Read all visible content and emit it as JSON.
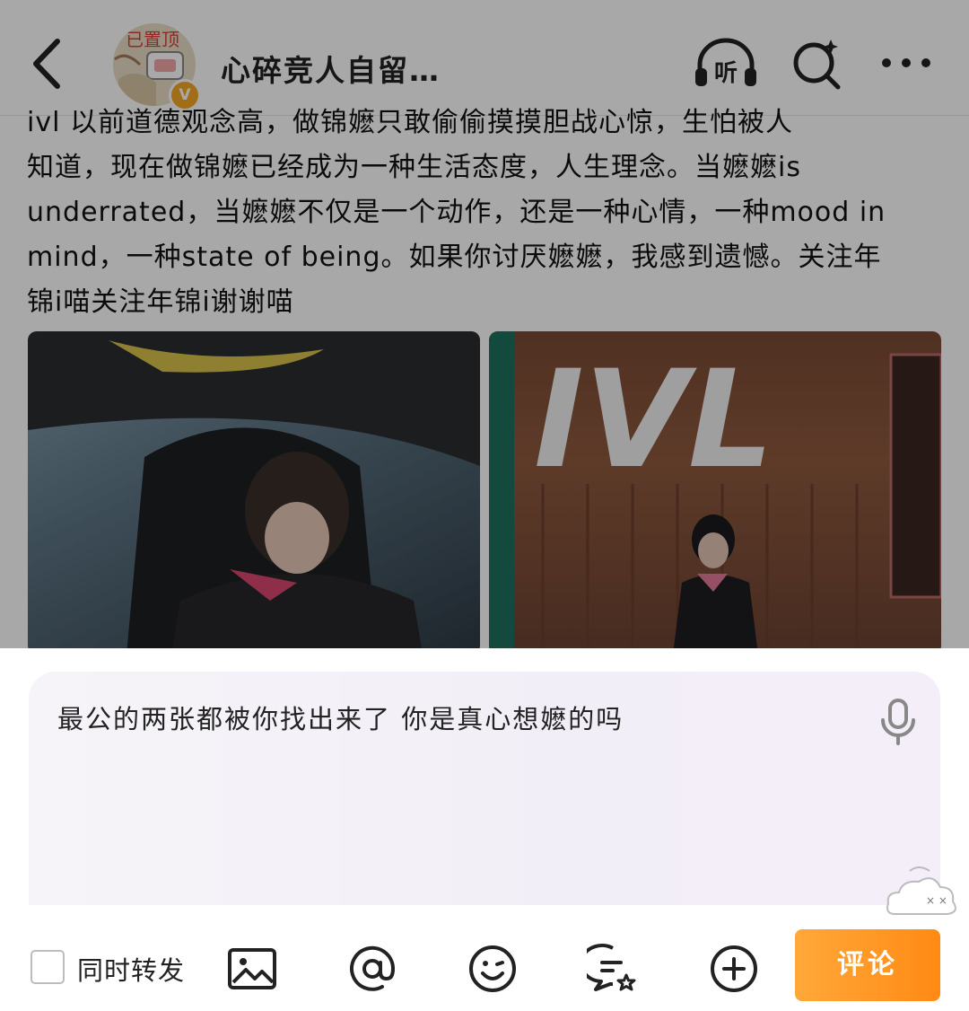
{
  "header": {
    "back_icon": "chevron-left-icon",
    "avatar_pin_text": "已置顶",
    "verified_badge": "V",
    "username": "心碎竞人自留…",
    "listen_label": "听",
    "search_icon": "search-sparkle-icon",
    "more_icon": "more-dots-icon"
  },
  "post": {
    "lines": [
      "ivl 以前道德观念高，做锦嬷只敢偷偷摸摸胆战心惊，生怕被人",
      "知道，现在做锦嬷已经成为一种生活态度，人生理念。当嬷嬷is",
      "underrated，当嬷嬷不仅是一个动作，还是一种心情，一种mood in",
      "mind，一种state of being。如果你讨厌嬷嬷，我感到遗憾。关注年",
      "锦i喵关注年锦i谢谢喵"
    ],
    "photo2_sign": "IVL"
  },
  "composer": {
    "comment_text": "最公的两张都被你找出来了 你是真心想嬷的吗",
    "repost_label": "同时转发",
    "repost_checked": false,
    "submit_label": "评论",
    "tools": [
      "image-icon",
      "at-icon",
      "emoji-icon",
      "topic-chat-icon",
      "plus-circle-icon"
    ]
  },
  "colors": {
    "accent": "#ff8a13",
    "dim_overlay": "rgba(0,0,0,0.34)",
    "verified": "#f5a623"
  }
}
